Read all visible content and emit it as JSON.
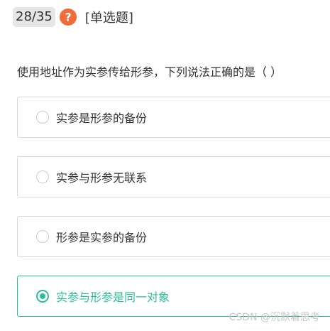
{
  "header": {
    "counter": "28/35",
    "question_type": "[单选题]"
  },
  "question": {
    "text": "使用地址作为实参传给形参，下列说法正确的是（  ）"
  },
  "options": [
    {
      "label": "实参是形参的备份",
      "selected": false
    },
    {
      "label": "实参与形参无联系",
      "selected": false
    },
    {
      "label": "形参是实参的备份",
      "selected": false
    },
    {
      "label": "实参与形参是同一对象",
      "selected": true
    }
  ],
  "watermark": "CSDN @沉默着思考",
  "colors": {
    "accent": "#2bbf97",
    "help_icon": "#f26b3a",
    "counter_bg": "#e6e6e6"
  },
  "icons": {
    "help": "question-circle-icon",
    "radio": "radio-circle-icon"
  }
}
